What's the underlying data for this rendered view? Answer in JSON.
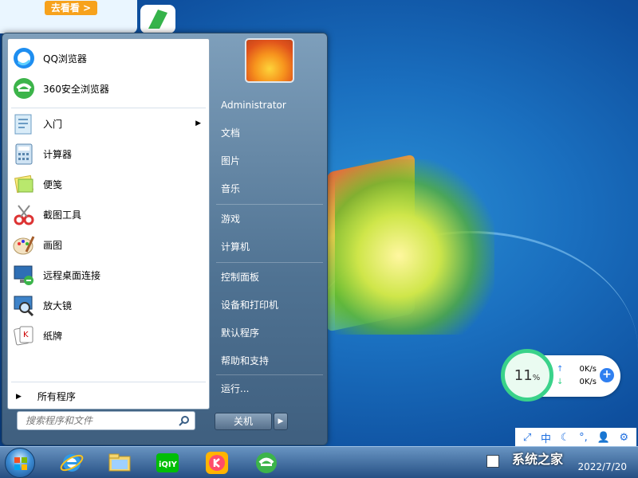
{
  "desktop": {
    "top_ad_button": "去看看 >"
  },
  "start_menu": {
    "pinned": [
      {
        "label": "QQ浏览器",
        "icon": "qq-browser-icon"
      },
      {
        "label": "360安全浏览器",
        "icon": "360-browser-icon"
      }
    ],
    "recent": [
      {
        "label": "入门",
        "icon": "getting-started-icon",
        "has_submenu": true
      },
      {
        "label": "计算器",
        "icon": "calculator-icon",
        "has_submenu": false
      },
      {
        "label": "便笺",
        "icon": "sticky-notes-icon",
        "has_submenu": false
      },
      {
        "label": "截图工具",
        "icon": "snipping-tool-icon",
        "has_submenu": false
      },
      {
        "label": "画图",
        "icon": "paint-icon",
        "has_submenu": false
      },
      {
        "label": "远程桌面连接",
        "icon": "remote-desktop-icon",
        "has_submenu": false
      },
      {
        "label": "放大镜",
        "icon": "magnifier-icon",
        "has_submenu": false
      },
      {
        "label": "纸牌",
        "icon": "solitaire-icon",
        "has_submenu": false
      }
    ],
    "all_programs": "所有程序",
    "search_placeholder": "搜索程序和文件",
    "right": {
      "user": "Administrator",
      "items_group1": [
        "文档",
        "图片",
        "音乐"
      ],
      "items_group2": [
        "游戏",
        "计算机"
      ],
      "items_group3": [
        "控制面板",
        "设备和打印机",
        "默认程序",
        "帮助和支持"
      ],
      "items_group4": [
        "运行..."
      ]
    },
    "shutdown_label": "关机"
  },
  "net_widget": {
    "percent": "11",
    "percent_unit": "%",
    "upload": "0K/s",
    "download": "0K/s"
  },
  "ime_bar": {
    "mode": "中"
  },
  "taskbar": {
    "clock_date": "2022/7/20"
  },
  "watermark": {
    "text": "系统之家"
  }
}
